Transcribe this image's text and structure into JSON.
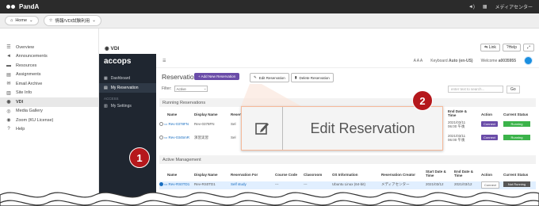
{
  "topbar": {
    "brand": "PandA",
    "right_text": "メディアセンター"
  },
  "subbar": {
    "home": "Home",
    "site": "情報/VDI試験利用"
  },
  "sidebar": {
    "items": [
      {
        "label": "Overview",
        "icon": "list-icon"
      },
      {
        "label": "Announcements",
        "icon": "megaphone-icon"
      },
      {
        "label": "Resources",
        "icon": "folder-icon"
      },
      {
        "label": "Assignments",
        "icon": "clipboard-icon"
      },
      {
        "label": "Email Archive",
        "icon": "mail-icon"
      },
      {
        "label": "Site Info",
        "icon": "info-icon"
      },
      {
        "label": "VDI",
        "icon": "globe-icon"
      },
      {
        "label": "Media Gallery",
        "icon": "media-icon"
      },
      {
        "label": "Zoom (KU License)",
        "icon": "camera-icon"
      },
      {
        "label": "Help",
        "icon": "help-icon"
      }
    ]
  },
  "vdi": {
    "title": "VDI",
    "link_btn": "Link",
    "help_btn": "Help"
  },
  "accops": {
    "logo": "accops",
    "nav": [
      {
        "label": "Dashboard"
      },
      {
        "label": "My Reservation"
      }
    ],
    "section": "ACCESS",
    "settings": "My Settings"
  },
  "header": {
    "font_controls": "A  A  A",
    "keyboard": "Keyboard",
    "keyboard_value": "Auto (en-US)",
    "welcome": "Welcome",
    "user": "a0035955"
  },
  "reservation": {
    "title": "Reservation",
    "add_btn": "Add New Reservation",
    "edit_btn": "Edit Reservation",
    "delete_btn": "Delete Reservation",
    "filter_label": "Filter:",
    "filter_value": "Active",
    "search_placeholder": "enter text to search...",
    "go": "Go"
  },
  "running": {
    "title": "Running Reservations",
    "headers": [
      "Name",
      "Display Name",
      "Reserv",
      "End Date & Time",
      "Action",
      "Current Status"
    ],
    "rows": [
      {
        "name": "Rev-0378FN",
        "display": "Rev-0378FN",
        "reserv": "Sel",
        "end": "2021/03/11 06:00 午後",
        "action": "Connect",
        "status": "Running"
      },
      {
        "name": "Rev-0345mR",
        "display": "演習実習",
        "reserv": "Sel",
        "end": "2021/03/11 06:00 午後",
        "action": "Connect",
        "status": "Running"
      }
    ]
  },
  "active": {
    "title": "Active Management",
    "headers": [
      "Name",
      "Display Name",
      "Reservation For",
      "Course Code",
      "Classroom",
      "OS Information",
      "Reservation Creator",
      "Start Date & Time",
      "End Date & Time",
      "Action",
      "Current Status"
    ],
    "row": {
      "name": "Rev-RS0TD1",
      "display": "Rev-RS0TD1",
      "for": "Self study",
      "course": "---",
      "room": "---",
      "os": "Ubuntu Linux (64-bit)",
      "creator": "メディアセンター",
      "start": "2021/03/12",
      "end": "2021/03/12",
      "action": "Connect",
      "status": "Not Running"
    }
  },
  "zoom": {
    "label": "Edit Reservation",
    "icon": "edit-icon"
  },
  "badges": {
    "one": "1",
    "two": "2"
  }
}
